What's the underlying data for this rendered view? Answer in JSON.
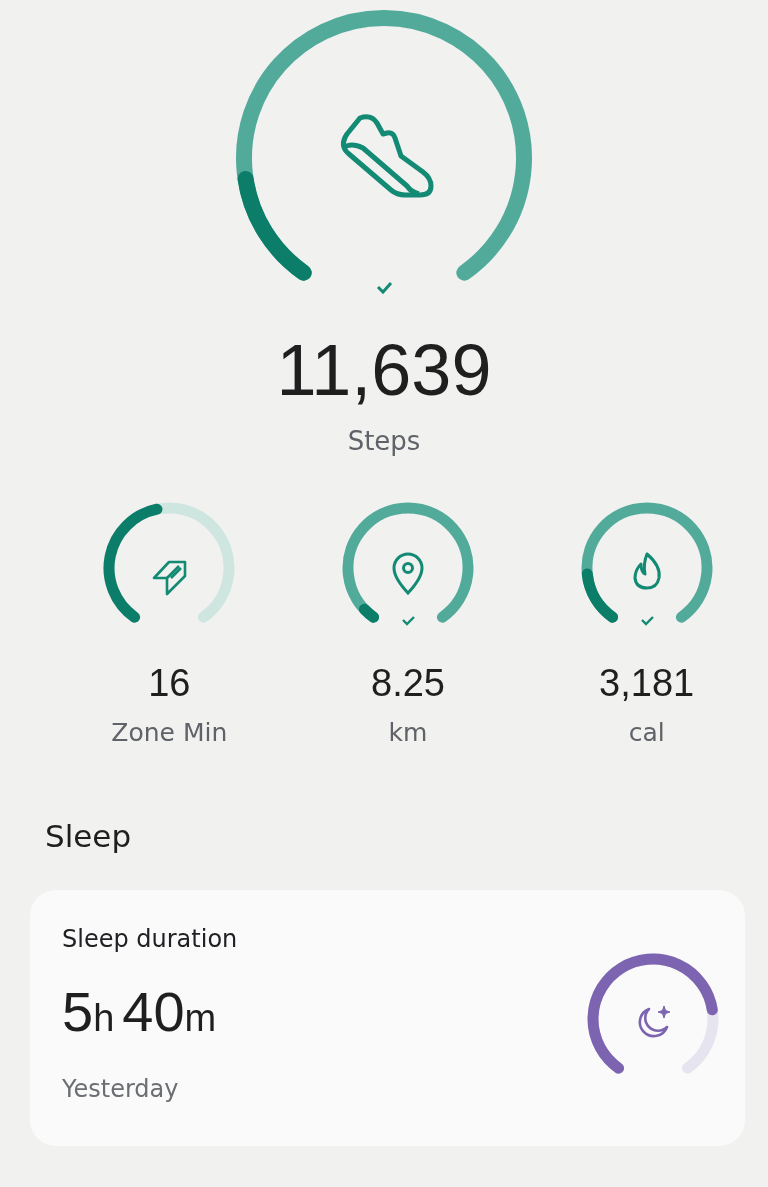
{
  "steps": {
    "value": "11,639",
    "label": "Steps",
    "completed": true
  },
  "metrics": [
    {
      "kind": "zone",
      "value": "16",
      "label": "Zone Min",
      "completed": false
    },
    {
      "kind": "distance",
      "value": "8.25",
      "label": "km",
      "completed": true
    },
    {
      "kind": "calories",
      "value": "3,181",
      "label": "cal",
      "completed": true
    }
  ],
  "sleep": {
    "section_title": "Sleep",
    "card_title": "Sleep duration",
    "duration": [
      {
        "kind": "number",
        "text": "5"
      },
      {
        "kind": "unit",
        "text": "h"
      },
      {
        "kind": "number",
        "text": "40"
      },
      {
        "kind": "unit",
        "text": "m"
      }
    ],
    "caption": "Yesterday"
  }
}
